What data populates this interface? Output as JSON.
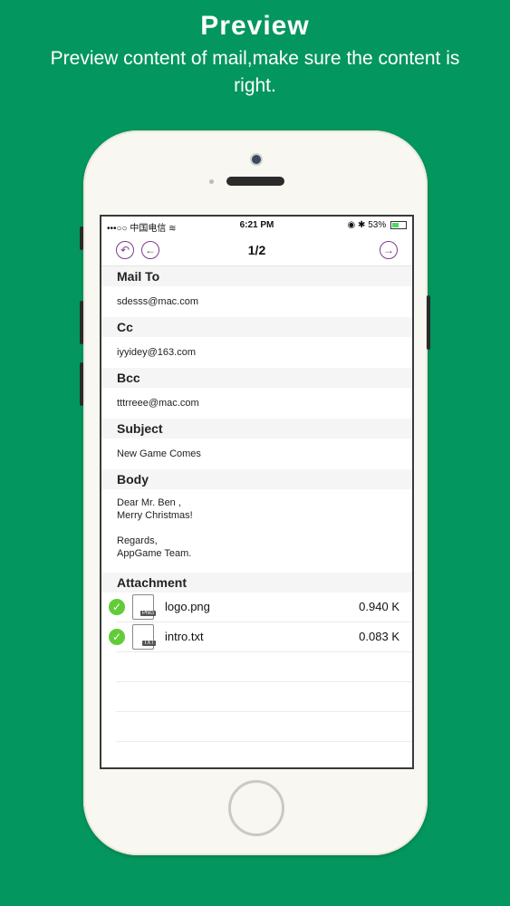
{
  "headline": {
    "title": "Preview",
    "subtitle": "Preview content of mail,make sure the content is right."
  },
  "status_bar": {
    "carrier": "•••○○ 中国电信",
    "time": "6:21 PM",
    "battery": "53%",
    "battery_level": 0.53
  },
  "nav": {
    "back_icon": "undo-icon",
    "prev_icon": "arrow-left-icon",
    "next_icon": "arrow-right-icon",
    "title": "1/2"
  },
  "mail": {
    "to_label": "Mail To",
    "to_value": "sdesss@mac.com",
    "cc_label": "Cc",
    "cc_value": "iyyidey@163.com",
    "bcc_label": "Bcc",
    "bcc_value": "tttrreee@mac.com",
    "subject_label": "Subject",
    "subject_value": "New Game Comes",
    "body_label": "Body",
    "body_value": "Dear Mr. Ben ,\nMerry Christmas!\n\nRegards,\nAppGame Team.",
    "attachment_label": "Attachment"
  },
  "attachments": [
    {
      "name": "logo.png",
      "type": "PNG",
      "size": "0.940 K"
    },
    {
      "name": "intro.txt",
      "type": "TXT",
      "size": "0.083 K"
    }
  ],
  "colors": {
    "background": "#04965f",
    "accent": "#7b3e8c",
    "check": "#62cb3a"
  }
}
